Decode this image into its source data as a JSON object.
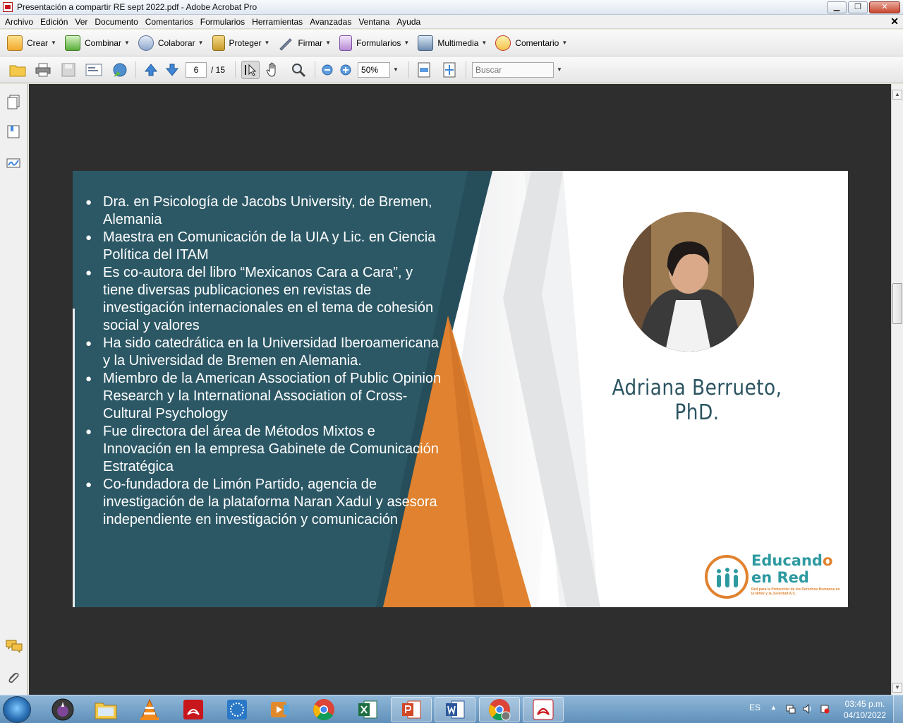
{
  "window": {
    "title": "Presentación a compartir RE sept 2022.pdf - Adobe Acrobat Pro",
    "minimize": "▁",
    "maximize": "❐",
    "close": "✕"
  },
  "menu": {
    "items": [
      "Archivo",
      "Edición",
      "Ver",
      "Documento",
      "Comentarios",
      "Formularios",
      "Herramientas",
      "Avanzadas",
      "Ventana",
      "Ayuda"
    ],
    "close_doc": "✕"
  },
  "tasks": [
    {
      "label": "Crear",
      "icon": "create-pdf-icon"
    },
    {
      "label": "Combinar",
      "icon": "combine-icon"
    },
    {
      "label": "Colaborar",
      "icon": "collaborate-icon"
    },
    {
      "label": "Proteger",
      "icon": "lock-icon"
    },
    {
      "label": "Firmar",
      "icon": "pen-icon"
    },
    {
      "label": "Formularios",
      "icon": "forms-icon"
    },
    {
      "label": "Multimedia",
      "icon": "multimedia-icon"
    },
    {
      "label": "Comentario",
      "icon": "comment-icon"
    }
  ],
  "nav": {
    "current_page": "6",
    "page_count": "/ 15",
    "zoom": "50%",
    "search_placeholder": "Buscar"
  },
  "slide": {
    "bullets": [
      "Dra. en Psicología de Jacobs University, de Bremen, Alemania",
      "Maestra en Comunicación de la UIA y Lic. en Ciencia Política del ITAM",
      "Es co-autora del libro “Mexicanos Cara a Cara”, y tiene diversas publicaciones en revistas de investigación internacionales en el tema de cohesión social y valores",
      "Ha sido catedrática en la Universidad Iberoamericana y la Universidad de Bremen en Alemania.",
      " Miembro de la American Association of Public Opinion Research y la International Association of Cross-Cultural Psychology",
      "Fue directora del área de Métodos Mixtos e Innovación en la empresa Gabinete de Comunicación Estratégica",
      "Co-fundadora de Limón Partido, agencia de investigación de la plataforma Naran Xadul y asesora independiente en investigación y comunicación"
    ],
    "name": "Adriana Berrueto, PhD.",
    "logo": {
      "line1_a": "Educand",
      "line1_b": "o",
      "line2": "en Red",
      "tagline": "Red para la Protección de los Derechos Humanos en la Niñez y la Juventud A.C."
    },
    "colors": {
      "teal": "#2c5866",
      "orange": "#e0822f",
      "name": "#2c5462"
    }
  },
  "taskbar": {
    "language": "ES",
    "time": "03:45 p.m.",
    "date": "04/10/2022",
    "apps": [
      "start-orb",
      "tor-browser",
      "file-explorer",
      "vlc",
      "acrobat-reader",
      "app-blue",
      "media-player",
      "chrome",
      "excel",
      "powerpoint",
      "word",
      "chrome-profile",
      "acrobat-pro"
    ]
  }
}
